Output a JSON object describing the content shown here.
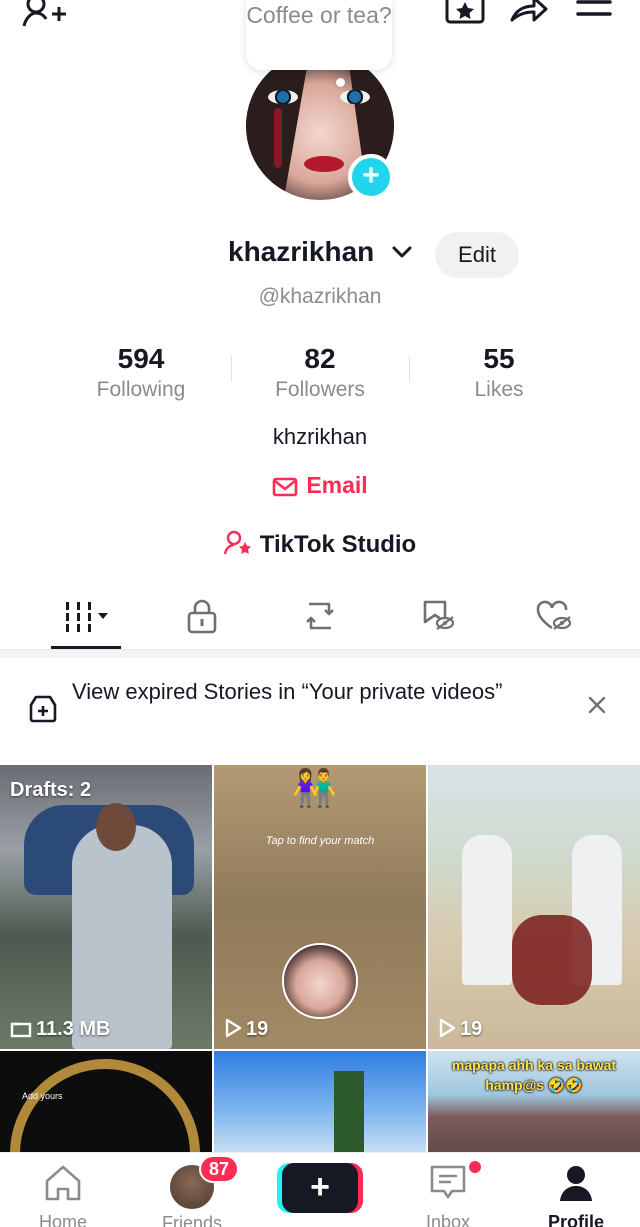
{
  "profile": {
    "note": "Coffee or tea?",
    "username": "khazrikhan",
    "handle": "@khazrikhan",
    "edit_label": "Edit",
    "bio": "khzrikhan",
    "email_label": "Email",
    "studio_label": "TikTok Studio"
  },
  "stats": [
    {
      "value": "594",
      "label": "Following"
    },
    {
      "value": "82",
      "label": "Followers"
    },
    {
      "value": "55",
      "label": "Likes"
    }
  ],
  "banner": {
    "text": "View expired Stories in “Your private videos”"
  },
  "grid": [
    {
      "overlay_top": "Drafts: 2",
      "caption": "11.3 MB",
      "caption_icon": "folder-icon"
    },
    {
      "overlay_top": "👫",
      "caption": "19",
      "caption_icon": "play-icon",
      "overlay_text": "Tap to find your match"
    },
    {
      "caption": "19",
      "caption_icon": "play-icon"
    },
    {
      "overlay_text": "Add yours"
    },
    {},
    {
      "overlay_text": "mapapa ahh ka sa bawat hamp@s 🤣🤣"
    }
  ],
  "nav": {
    "home": "Home",
    "friends": "Friends",
    "friends_badge": "87",
    "inbox": "Inbox",
    "profile": "Profile"
  },
  "colors": {
    "accent": "#fe2c55",
    "cyan": "#20d5ec",
    "text": "#161823",
    "muted": "#8a8b91"
  }
}
